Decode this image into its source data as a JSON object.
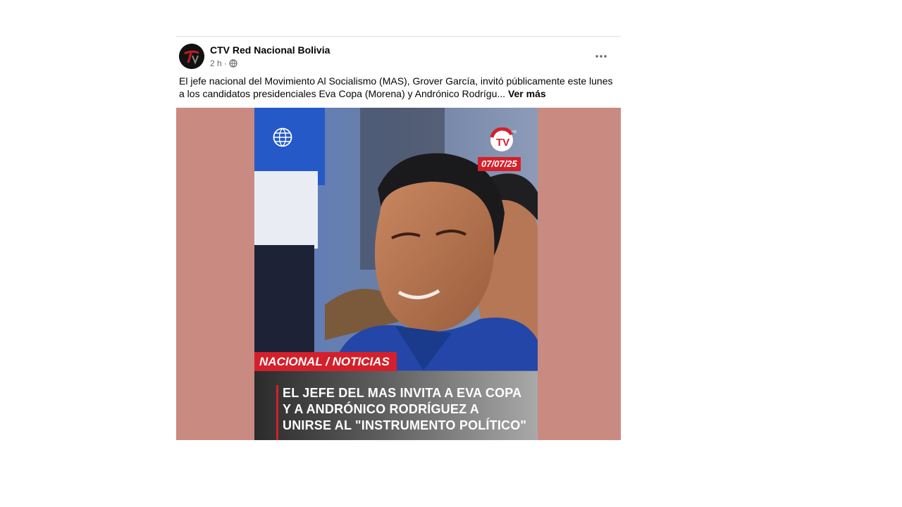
{
  "post": {
    "author": "CTV Red Nacional Bolivia",
    "time": "2 h",
    "separator": "·",
    "audience_icon": "globe-icon",
    "more_icon": "more-options-icon",
    "text": "El jefe nacional del Movimiento Al Socialismo (MAS), Grover García, invitó públicamente este lunes a los candidatos presidenciales Eva Copa (Morena) y Andrónico Rodrígu...",
    "see_more": "Ver más"
  },
  "image": {
    "date": "07/07/25",
    "section": "NACIONAL / NOTICIAS",
    "headline_lines": [
      "EL JEFE DEL MAS INVITA A EVA COPA",
      "Y A ANDRÓNICO RODRÍGUEZ A",
      "UNIRSE AL \"INSTRUMENTO POLÍTICO\""
    ],
    "logo_text": "TV",
    "logo_hd": "HD"
  },
  "colors": {
    "media_background": "#c98a82",
    "accent_red": "#d4202a",
    "secondary_text": "#65676b"
  }
}
